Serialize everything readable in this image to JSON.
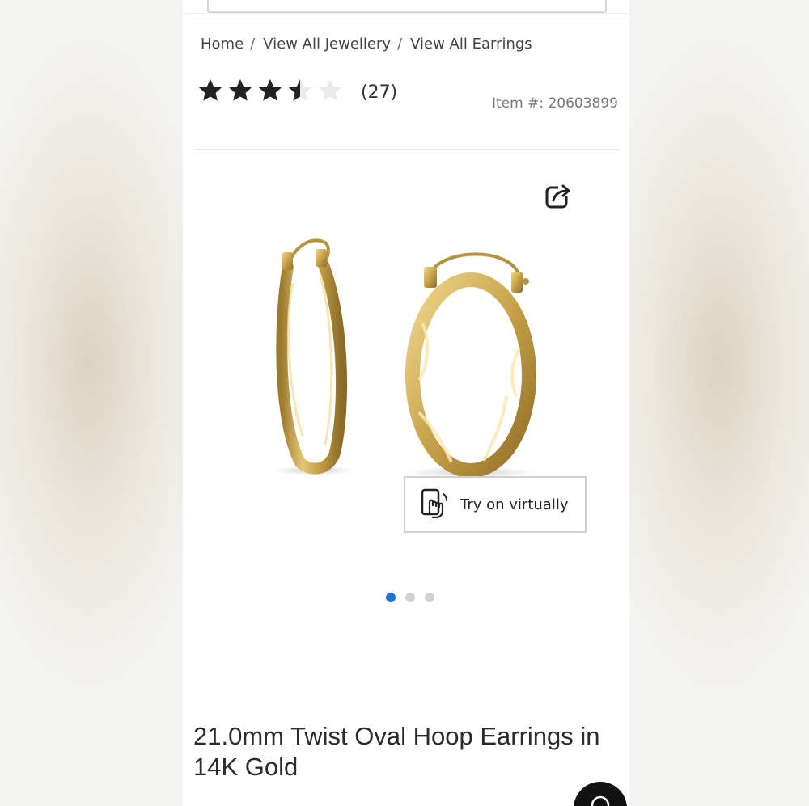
{
  "breadcrumb": {
    "items": [
      "Home",
      "View All Jewellery",
      "View All Earrings"
    ],
    "separator": "/"
  },
  "rating": {
    "value": 3.5,
    "max": 5,
    "count_label": "(27)"
  },
  "item_number": "Item #: 20603899",
  "product": {
    "title": "21.0mm Twist Oval Hoop Earrings in 14K Gold",
    "metal_color": "#c9a44c"
  },
  "try_on": {
    "label": "Try on virtually",
    "icon": "hand-phone-icon"
  },
  "carousel": {
    "count": 3,
    "active_index": 0,
    "active_color": "#1e74d6"
  },
  "icons": {
    "share": "share-icon",
    "chat": "chat-icon"
  }
}
